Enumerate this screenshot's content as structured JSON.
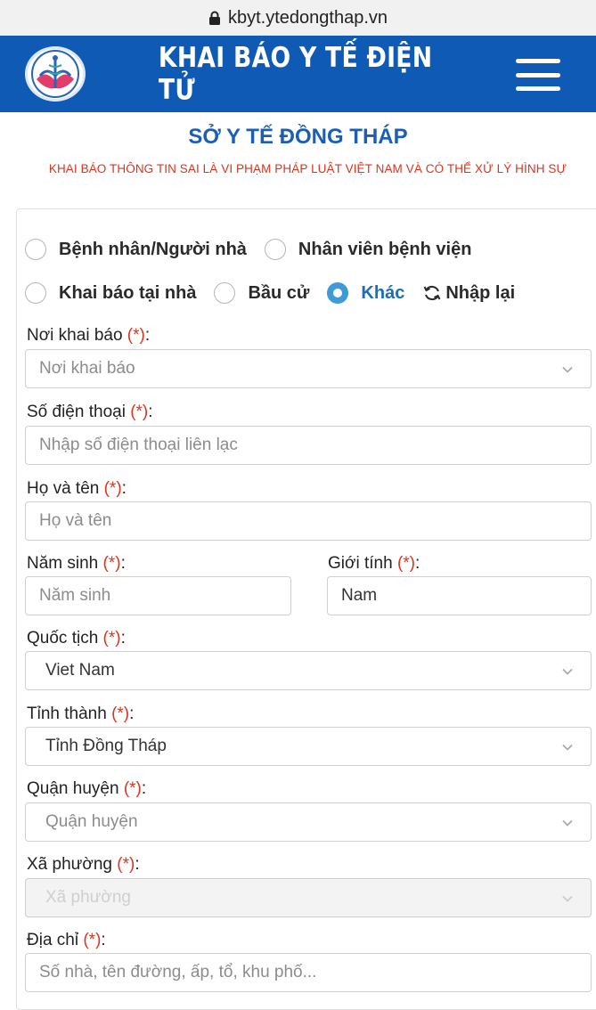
{
  "browser": {
    "url": "kbyt.ytedongthap.vn"
  },
  "header": {
    "title": "KHAI BÁO Y TẾ ĐIỆN TỬ",
    "logo_text": "SỞ Y TẾ ĐỒNG THÁP"
  },
  "org_title": "SỞ Y TẾ ĐỒNG THÁP",
  "warning": "KHAI BÁO THÔNG TIN SAI LÀ VI PHẠM PHÁP LUẬT VIỆT NAM VÀ CÓ THỂ XỬ LÝ HÌNH SỰ",
  "radios": {
    "patient": "Bệnh nhân/Người nhà",
    "staff": "Nhân viên bệnh viện",
    "home": "Khai báo tại nhà",
    "election": "Bầu cử",
    "other": "Khác",
    "selected": "other"
  },
  "reset_label": "Nhập lại",
  "required_mark": "(*)",
  "fields": {
    "place": {
      "label": "Nơi khai báo",
      "placeholder": "Nơi khai báo"
    },
    "phone": {
      "label": "Số điện thoại",
      "placeholder": "Nhập số điện thoại liên lạc"
    },
    "name": {
      "label": "Họ và tên",
      "placeholder": "Họ và tên"
    },
    "birth_year": {
      "label": "Năm sinh",
      "placeholder": "Năm sinh"
    },
    "gender": {
      "label": "Giới tính",
      "value": "Nam"
    },
    "nationality": {
      "label": "Quốc tịch",
      "value": "Viet Nam"
    },
    "province": {
      "label": "Tỉnh thành",
      "value": "Tỉnh Đồng Tháp"
    },
    "district": {
      "label": "Quận huyện",
      "placeholder": "Quận huyện"
    },
    "ward": {
      "label": "Xã phường",
      "placeholder": "Xã phường"
    },
    "address": {
      "label": "Địa chỉ",
      "placeholder": "Số nhà, tên đường, ấp, tổ, khu phố..."
    }
  },
  "colors": {
    "header_bg": "#0f5ab4",
    "accent": "#1b5fb5",
    "warning": "#e0321c",
    "radio_checked": "#3f9ad8"
  }
}
